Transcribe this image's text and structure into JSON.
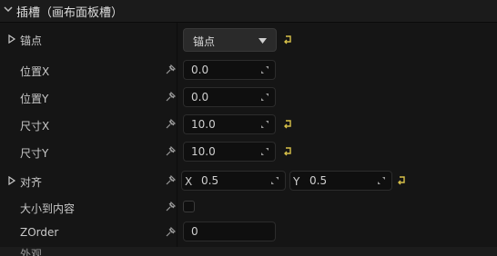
{
  "header": {
    "title": "插槽（画布面板槽）"
  },
  "rows": {
    "anchors": {
      "label": "锚点",
      "dropdown_value": "锚点"
    },
    "position_x": {
      "label": "位置X",
      "value": "0.0"
    },
    "position_y": {
      "label": "位置Y",
      "value": "0.0"
    },
    "size_x": {
      "label": "尺寸X",
      "value": "10.0"
    },
    "size_y": {
      "label": "尺寸Y",
      "value": "10.0"
    },
    "alignment": {
      "label": "对齐",
      "x_label": "X",
      "x_value": "0.5",
      "y_label": "Y",
      "y_value": "0.5"
    },
    "size_to_content": {
      "label": "大小到内容",
      "checked": false
    },
    "zorder": {
      "label": "ZOrder",
      "value": "0"
    }
  },
  "bottom": {
    "partial_label": "外观"
  },
  "colors": {
    "reset_arrow": "#d9c24a",
    "background": "#151515",
    "field": "#0f0f0f"
  },
  "icons": [
    "chevron-down-icon",
    "expand-arrow-icon",
    "pin-icon",
    "drag-handle-icon",
    "reset-arrow-icon",
    "dropdown-arrow-icon"
  ]
}
